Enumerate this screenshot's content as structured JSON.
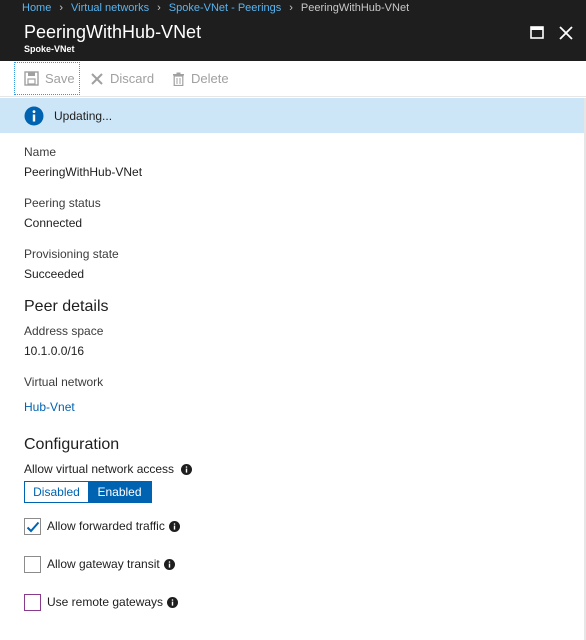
{
  "breadcrumb": {
    "items": [
      "Home",
      "Virtual networks",
      "Spoke-VNet - Peerings"
    ],
    "current": "PeeringWithHub-VNet"
  },
  "blade": {
    "title": "PeeringWithHub-VNet",
    "subtitle": "Spoke-VNet"
  },
  "toolbar": {
    "save_label": "Save",
    "discard_label": "Discard",
    "delete_label": "Delete"
  },
  "banner": {
    "message": "Updating..."
  },
  "properties": {
    "name_label": "Name",
    "name_value": "PeeringWithHub-VNet",
    "status_label": "Peering status",
    "status_value": "Connected",
    "provisioning_label": "Provisioning state",
    "provisioning_value": "Succeeded"
  },
  "peer_details": {
    "heading": "Peer details",
    "address_label": "Address space",
    "address_value": "10.1.0.0/16",
    "vnet_label": "Virtual network",
    "vnet_value": "Hub-Vnet"
  },
  "configuration": {
    "heading": "Configuration",
    "access_label": "Allow virtual network access",
    "toggle_off": "Disabled",
    "toggle_on": "Enabled",
    "selected": "Enabled",
    "forwarded_label": "Allow forwarded traffic",
    "forwarded_checked": true,
    "gateway_transit_label": "Allow gateway transit",
    "gateway_transit_checked": false,
    "remote_gateways_label": "Use remote gateways",
    "remote_gateways_checked": false
  },
  "colors": {
    "header_bg": "#1e1e1e",
    "link": "#0063b1",
    "banner_bg": "#cde6f7",
    "accent": "#0063b1"
  }
}
